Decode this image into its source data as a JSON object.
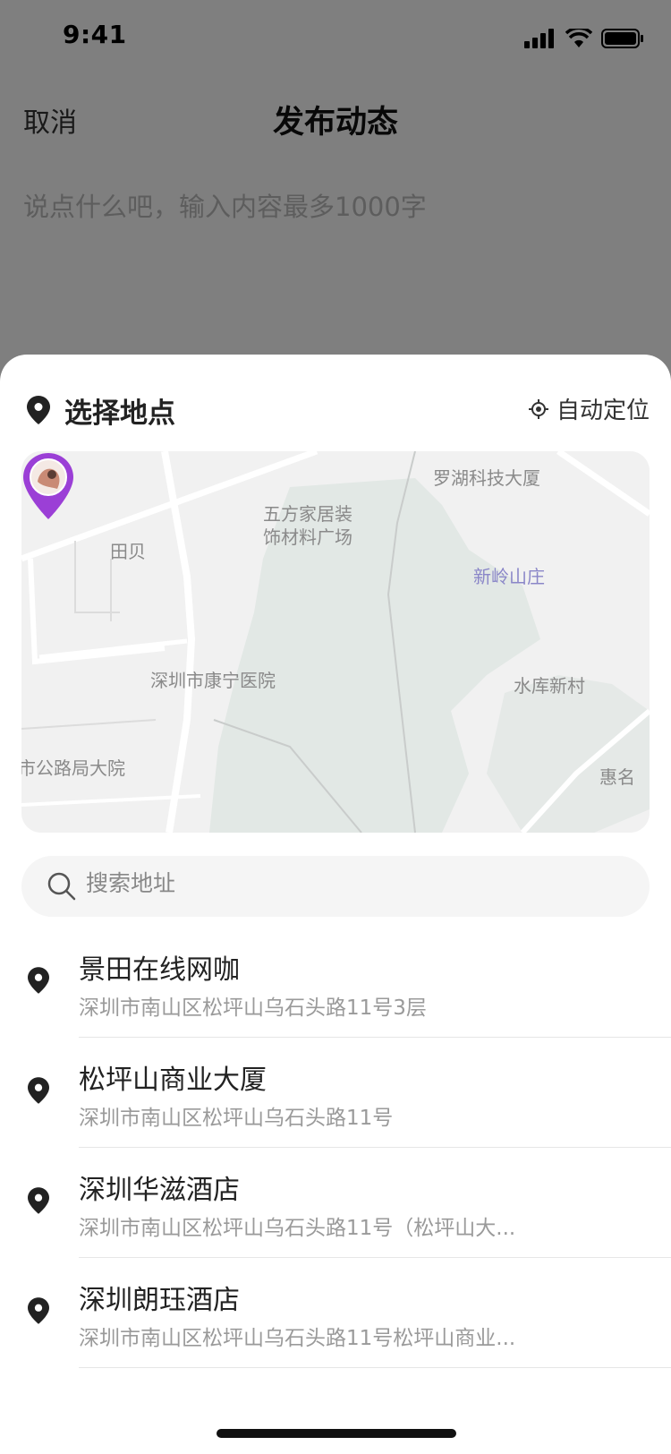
{
  "status_bar": {
    "time": "9:41"
  },
  "nav": {
    "cancel_label": "取消",
    "title": "发布动态"
  },
  "post": {
    "placeholder": "说点什么吧，输入内容最多1000字"
  },
  "sheet": {
    "title": "选择地点",
    "auto_locate_label": "自动定位",
    "map": {
      "labels": [
        {
          "text": "罗湖科技大厦",
          "color": "gray"
        },
        {
          "text": "五方家居装",
          "color": "gray"
        },
        {
          "text": "饰材料广场",
          "color": "gray"
        },
        {
          "text": "田贝",
          "color": "gray"
        },
        {
          "text": "新岭山庄",
          "color": "blue"
        },
        {
          "text": "深圳市康宁医院",
          "color": "gray"
        },
        {
          "text": "水库新村",
          "color": "gray"
        },
        {
          "text": "市公路局大院",
          "color": "gray"
        },
        {
          "text": "惠名",
          "color": "gray"
        }
      ]
    },
    "search": {
      "placeholder": "搜索地址"
    },
    "places": [
      {
        "name": "景田在线网咖",
        "address": "深圳市南山区松坪山乌石头路11号3层"
      },
      {
        "name": "松坪山商业大厦",
        "address": "深圳市南山区松坪山乌石头路11号"
      },
      {
        "name": "深圳华滋酒店",
        "address": "深圳市南山区松坪山乌石头路11号（松坪山大..."
      },
      {
        "name": "深圳朗珏酒店",
        "address": "深圳市南山区松坪山乌石头路11号松坪山商业..."
      }
    ]
  },
  "colors": {
    "marker": "#9b3fd6",
    "dim_overlay": "rgba(0,0,0,0.5)",
    "map_park": "#e2e8e5"
  }
}
